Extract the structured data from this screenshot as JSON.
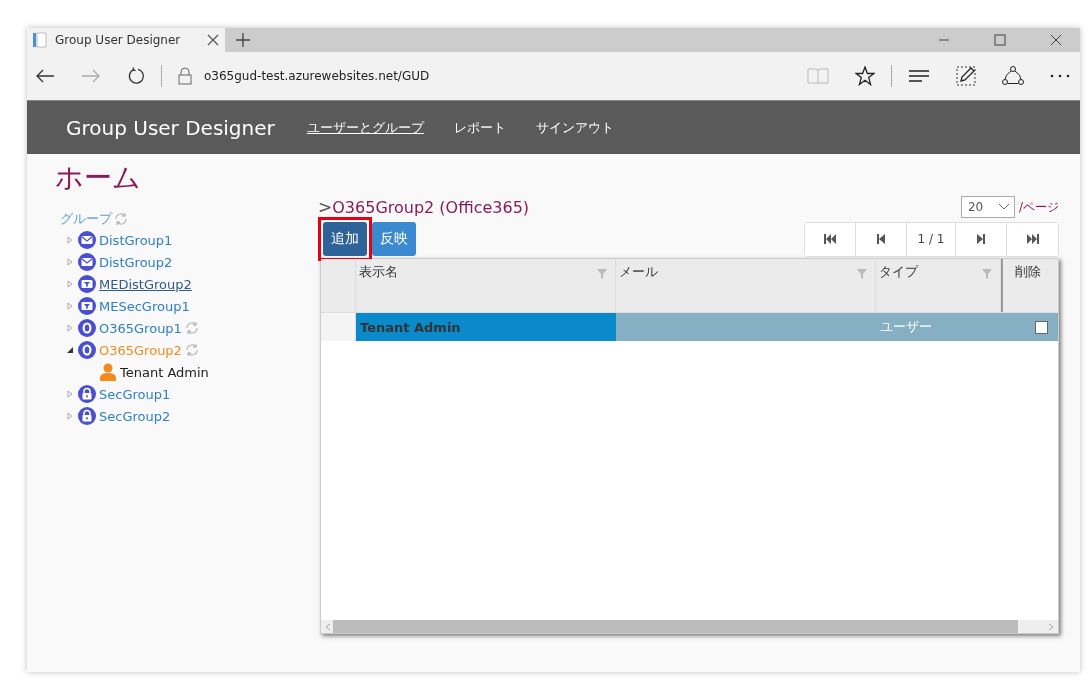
{
  "browser": {
    "tab_title": "Group User Designer",
    "address": "o365gud-test.azurewebsites.net/GUD"
  },
  "nav": {
    "brand": "Group User Designer",
    "links": [
      {
        "label": "ユーザーとグループ",
        "selected": true
      },
      {
        "label": "レポート",
        "selected": false
      },
      {
        "label": "サインアウト",
        "selected": false
      }
    ]
  },
  "page_title": "ホーム",
  "tree": {
    "label": "グループ",
    "items": [
      {
        "kind": "distribution",
        "label": "DistGroup1",
        "expanded": false,
        "selected": false,
        "underlined": false,
        "sync": false
      },
      {
        "kind": "distribution",
        "label": "DistGroup2",
        "expanded": false,
        "selected": false,
        "underlined": false,
        "sync": false
      },
      {
        "kind": "mail-enabled",
        "label": "MEDistGroup2",
        "expanded": false,
        "selected": false,
        "underlined": true,
        "sync": false
      },
      {
        "kind": "mail-enabled",
        "label": "MESecGroup1",
        "expanded": false,
        "selected": false,
        "underlined": false,
        "sync": false
      },
      {
        "kind": "office365",
        "label": "O365Group1",
        "expanded": false,
        "selected": false,
        "underlined": false,
        "sync": true
      },
      {
        "kind": "office365",
        "label": "O365Group2",
        "expanded": true,
        "selected": true,
        "underlined": false,
        "sync": true,
        "children": [
          {
            "label": "Tenant Admin"
          }
        ]
      },
      {
        "kind": "security",
        "label": "SecGroup1",
        "expanded": false,
        "selected": false,
        "underlined": false,
        "sync": false
      },
      {
        "kind": "security",
        "label": "SecGroup2",
        "expanded": false,
        "selected": false,
        "underlined": false,
        "sync": false
      }
    ]
  },
  "breadcrumb": {
    "separator": ">",
    "title": "O365Group2 (Office365)"
  },
  "page_size": {
    "value": "20",
    "suffix": "/ページ"
  },
  "buttons": [
    {
      "label": "追加",
      "highlighted": true
    },
    {
      "label": "反映",
      "highlighted": false
    }
  ],
  "pager": {
    "position": "1 / 1"
  },
  "table": {
    "columns": [
      "表示名",
      "メール",
      "タイプ",
      "削除"
    ],
    "rows": [
      {
        "display_name": "Tenant Admin",
        "type": "ユーザー",
        "checked": false,
        "selected": true
      }
    ]
  }
}
